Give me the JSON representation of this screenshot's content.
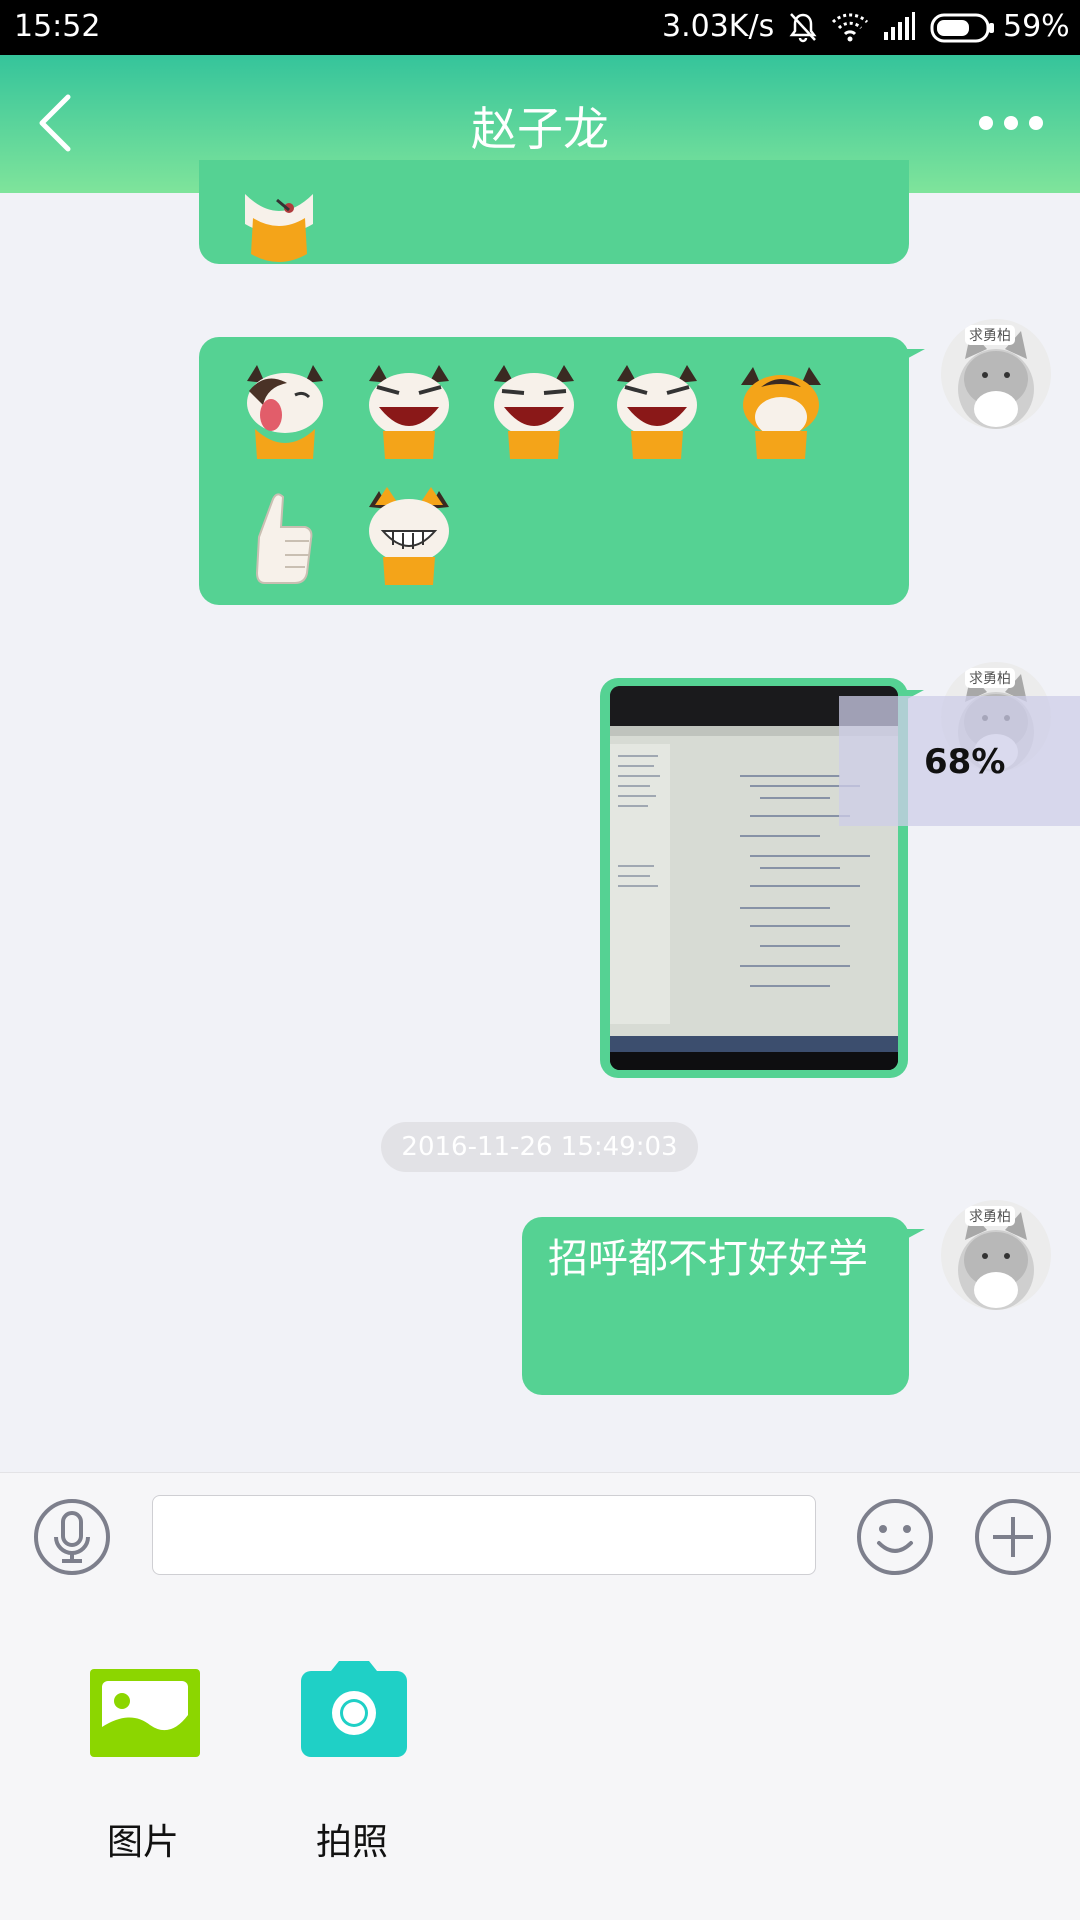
{
  "status_bar": {
    "time": "15:52",
    "network_speed": "3.03K/s",
    "battery_percent": "59%",
    "icons": [
      "bell-off-icon",
      "wifi-icon",
      "signal-icon",
      "battery-icon"
    ]
  },
  "header": {
    "title": "赵子龙",
    "back_icon": "chevron-left-icon",
    "more_icon": "more-dots-icon"
  },
  "messages": [
    {
      "type": "sticker",
      "sender": "self",
      "description_icon": "cow-sticker"
    },
    {
      "type": "sticker_row",
      "sender": "self",
      "count": 7,
      "avatar_tag": "求勇柏"
    },
    {
      "type": "image_upload",
      "sender": "self",
      "progress_text": "68%",
      "progress": 0.68,
      "avatar_tag": "求勇柏"
    },
    {
      "type": "timestamp",
      "text": "2016-11-26 15:49:03"
    },
    {
      "type": "text",
      "sender": "self",
      "text": "招呼都不打好好学",
      "avatar_tag": "求勇柏"
    }
  ],
  "input_bar": {
    "voice_icon": "microphone-icon",
    "input_value": "",
    "emoji_icon": "smiley-icon",
    "plus_icon": "plus-circle-icon"
  },
  "attach_panel": {
    "items": [
      {
        "label": "图片",
        "icon": "image-icon",
        "color": "#8cd600"
      },
      {
        "label": "拍照",
        "icon": "camera-icon",
        "color": "#1fd0c6"
      }
    ]
  },
  "colors": {
    "bubble": "#55d293",
    "header_top": "#35c49b",
    "header_bottom": "#7fe49b",
    "background": "#f1f2f7"
  }
}
